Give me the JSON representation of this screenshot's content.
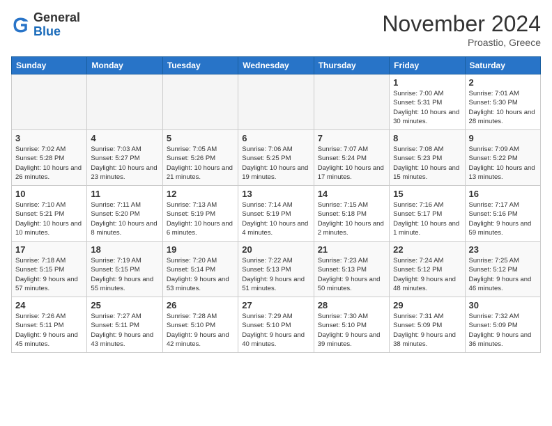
{
  "header": {
    "logo_line1": "General",
    "logo_line2": "Blue",
    "month": "November 2024",
    "location": "Proastio, Greece"
  },
  "weekdays": [
    "Sunday",
    "Monday",
    "Tuesday",
    "Wednesday",
    "Thursday",
    "Friday",
    "Saturday"
  ],
  "weeks": [
    [
      {
        "day": "",
        "empty": true
      },
      {
        "day": "",
        "empty": true
      },
      {
        "day": "",
        "empty": true
      },
      {
        "day": "",
        "empty": true
      },
      {
        "day": "",
        "empty": true
      },
      {
        "day": "1",
        "sunrise": "7:00 AM",
        "sunset": "5:31 PM",
        "daylight": "10 hours and 30 minutes."
      },
      {
        "day": "2",
        "sunrise": "7:01 AM",
        "sunset": "5:30 PM",
        "daylight": "10 hours and 28 minutes."
      }
    ],
    [
      {
        "day": "3",
        "sunrise": "7:02 AM",
        "sunset": "5:28 PM",
        "daylight": "10 hours and 26 minutes."
      },
      {
        "day": "4",
        "sunrise": "7:03 AM",
        "sunset": "5:27 PM",
        "daylight": "10 hours and 23 minutes."
      },
      {
        "day": "5",
        "sunrise": "7:05 AM",
        "sunset": "5:26 PM",
        "daylight": "10 hours and 21 minutes."
      },
      {
        "day": "6",
        "sunrise": "7:06 AM",
        "sunset": "5:25 PM",
        "daylight": "10 hours and 19 minutes."
      },
      {
        "day": "7",
        "sunrise": "7:07 AM",
        "sunset": "5:24 PM",
        "daylight": "10 hours and 17 minutes."
      },
      {
        "day": "8",
        "sunrise": "7:08 AM",
        "sunset": "5:23 PM",
        "daylight": "10 hours and 15 minutes."
      },
      {
        "day": "9",
        "sunrise": "7:09 AM",
        "sunset": "5:22 PM",
        "daylight": "10 hours and 13 minutes."
      }
    ],
    [
      {
        "day": "10",
        "sunrise": "7:10 AM",
        "sunset": "5:21 PM",
        "daylight": "10 hours and 10 minutes."
      },
      {
        "day": "11",
        "sunrise": "7:11 AM",
        "sunset": "5:20 PM",
        "daylight": "10 hours and 8 minutes."
      },
      {
        "day": "12",
        "sunrise": "7:13 AM",
        "sunset": "5:19 PM",
        "daylight": "10 hours and 6 minutes."
      },
      {
        "day": "13",
        "sunrise": "7:14 AM",
        "sunset": "5:19 PM",
        "daylight": "10 hours and 4 minutes."
      },
      {
        "day": "14",
        "sunrise": "7:15 AM",
        "sunset": "5:18 PM",
        "daylight": "10 hours and 2 minutes."
      },
      {
        "day": "15",
        "sunrise": "7:16 AM",
        "sunset": "5:17 PM",
        "daylight": "10 hours and 1 minute."
      },
      {
        "day": "16",
        "sunrise": "7:17 AM",
        "sunset": "5:16 PM",
        "daylight": "9 hours and 59 minutes."
      }
    ],
    [
      {
        "day": "17",
        "sunrise": "7:18 AM",
        "sunset": "5:15 PM",
        "daylight": "9 hours and 57 minutes."
      },
      {
        "day": "18",
        "sunrise": "7:19 AM",
        "sunset": "5:15 PM",
        "daylight": "9 hours and 55 minutes."
      },
      {
        "day": "19",
        "sunrise": "7:20 AM",
        "sunset": "5:14 PM",
        "daylight": "9 hours and 53 minutes."
      },
      {
        "day": "20",
        "sunrise": "7:22 AM",
        "sunset": "5:13 PM",
        "daylight": "9 hours and 51 minutes."
      },
      {
        "day": "21",
        "sunrise": "7:23 AM",
        "sunset": "5:13 PM",
        "daylight": "9 hours and 50 minutes."
      },
      {
        "day": "22",
        "sunrise": "7:24 AM",
        "sunset": "5:12 PM",
        "daylight": "9 hours and 48 minutes."
      },
      {
        "day": "23",
        "sunrise": "7:25 AM",
        "sunset": "5:12 PM",
        "daylight": "9 hours and 46 minutes."
      }
    ],
    [
      {
        "day": "24",
        "sunrise": "7:26 AM",
        "sunset": "5:11 PM",
        "daylight": "9 hours and 45 minutes."
      },
      {
        "day": "25",
        "sunrise": "7:27 AM",
        "sunset": "5:11 PM",
        "daylight": "9 hours and 43 minutes."
      },
      {
        "day": "26",
        "sunrise": "7:28 AM",
        "sunset": "5:10 PM",
        "daylight": "9 hours and 42 minutes."
      },
      {
        "day": "27",
        "sunrise": "7:29 AM",
        "sunset": "5:10 PM",
        "daylight": "9 hours and 40 minutes."
      },
      {
        "day": "28",
        "sunrise": "7:30 AM",
        "sunset": "5:10 PM",
        "daylight": "9 hours and 39 minutes."
      },
      {
        "day": "29",
        "sunrise": "7:31 AM",
        "sunset": "5:09 PM",
        "daylight": "9 hours and 38 minutes."
      },
      {
        "day": "30",
        "sunrise": "7:32 AM",
        "sunset": "5:09 PM",
        "daylight": "9 hours and 36 minutes."
      }
    ]
  ]
}
